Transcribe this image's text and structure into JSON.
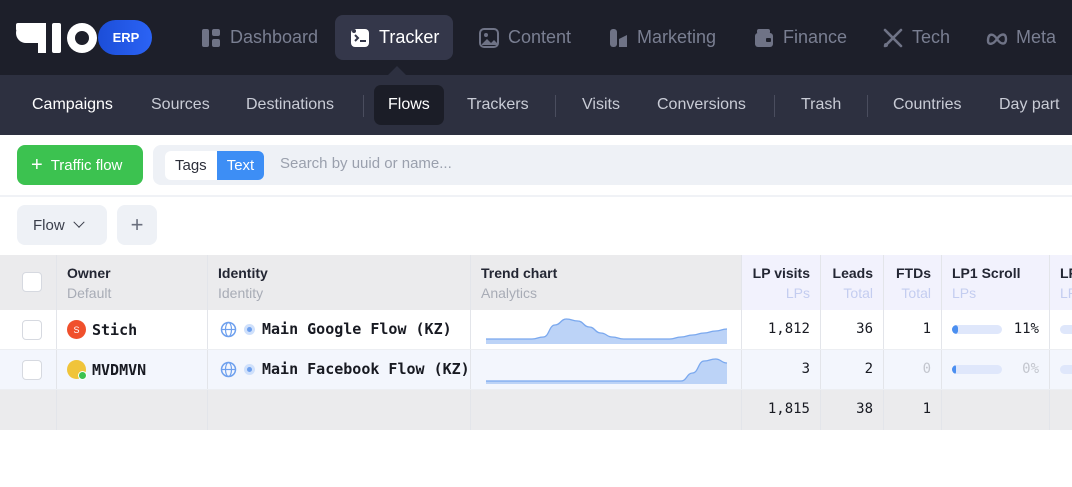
{
  "brand": {
    "logo": "aio",
    "badge": "ERP"
  },
  "nav": [
    {
      "label": "Dashboard",
      "icon": "dashboard-icon"
    },
    {
      "label": "Tracker",
      "icon": "tracker-icon",
      "active": true
    },
    {
      "label": "Content",
      "icon": "image-icon"
    },
    {
      "label": "Marketing",
      "icon": "marketing-icon"
    },
    {
      "label": "Finance",
      "icon": "wallet-icon"
    },
    {
      "label": "Tech",
      "icon": "tools-icon"
    },
    {
      "label": "Meta",
      "icon": "meta-icon"
    }
  ],
  "subnav": [
    {
      "label": "Campaigns"
    },
    {
      "label": "Sources"
    },
    {
      "label": "Destinations"
    },
    {
      "label": "Flows",
      "active": true
    },
    {
      "label": "Trackers"
    },
    {
      "label": "Visits"
    },
    {
      "label": "Conversions"
    },
    {
      "label": "Trash"
    },
    {
      "label": "Countries"
    },
    {
      "label": "Day part"
    }
  ],
  "toolbar": {
    "add_label": "Traffic flow",
    "toggle": {
      "tags": "Tags",
      "text": "Text",
      "selected": "Text"
    },
    "search_placeholder": "Search by uuid or name...",
    "group_label": "Flow"
  },
  "table": {
    "headers": {
      "owner": {
        "title": "Owner",
        "sub": "Default"
      },
      "identity": {
        "title": "Identity",
        "sub": "Identity"
      },
      "trend": {
        "title": "Trend chart",
        "sub": "Analytics"
      },
      "lp_visits": {
        "title": "LP visits",
        "sub": "LPs"
      },
      "leads": {
        "title": "Leads",
        "sub": "Total"
      },
      "ftds": {
        "title": "FTDs",
        "sub": "Total"
      },
      "lp1_scroll": {
        "title": "LP1 Scroll",
        "sub": "LPs"
      },
      "next": {
        "title": "LP",
        "sub": "LP"
      }
    },
    "rows": [
      {
        "owner": "Stich",
        "avatar_letter": "S",
        "identity": "Main Google Flow (KZ)",
        "lp_visits": "1,812",
        "leads": "36",
        "ftds": "1",
        "lp1_scroll_pct": "11%",
        "lp1_scroll_value": 0.11,
        "trend": [
          2,
          2,
          2,
          2,
          2,
          3,
          9,
          12,
          11,
          8,
          5,
          3,
          2,
          2,
          2,
          2,
          2,
          3,
          4,
          5,
          6,
          7
        ]
      },
      {
        "owner": "MVDMVN",
        "avatar_letter": "",
        "identity": "Main Facebook Flow (KZ)",
        "lp_visits": "3",
        "leads": "2",
        "ftds": "0",
        "lp1_scroll_pct": "0%",
        "lp1_scroll_value": 0.0,
        "trend": [
          1,
          1,
          1,
          1,
          1,
          1,
          1,
          1,
          1,
          1,
          1,
          1,
          1,
          1,
          1,
          1,
          1,
          1,
          5,
          11,
          12,
          10
        ]
      }
    ],
    "totals": {
      "lp_visits": "1,815",
      "leads": "38",
      "ftds": "1"
    }
  },
  "colors": {
    "accent": "#3d8ef5",
    "success": "#3cc250",
    "topbar": "#1d1f2a",
    "subbar": "#2d3040",
    "spark_fill": "#bcd3f7",
    "spark_line": "#7aa8ee"
  }
}
